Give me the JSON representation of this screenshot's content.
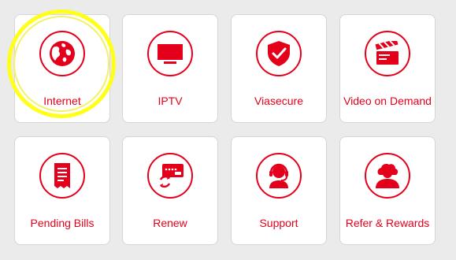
{
  "colors": {
    "accent": "#e4001b",
    "background": "#ebebeb",
    "tile": "#ffffff",
    "highlight": "#ffff1a"
  },
  "tiles": [
    {
      "label": "Internet",
      "icon": "globe-icon"
    },
    {
      "label": "IPTV",
      "icon": "tv-icon"
    },
    {
      "label": "Viasecure",
      "icon": "shield-check-icon"
    },
    {
      "label": "Video on Demand",
      "icon": "clapperboard-icon"
    },
    {
      "label": "Pending Bills",
      "icon": "receipt-icon"
    },
    {
      "label": "Renew",
      "icon": "renew-card-icon"
    },
    {
      "label": "Support",
      "icon": "headset-agent-icon"
    },
    {
      "label": "Refer & Rewards",
      "icon": "refer-user-icon"
    }
  ]
}
